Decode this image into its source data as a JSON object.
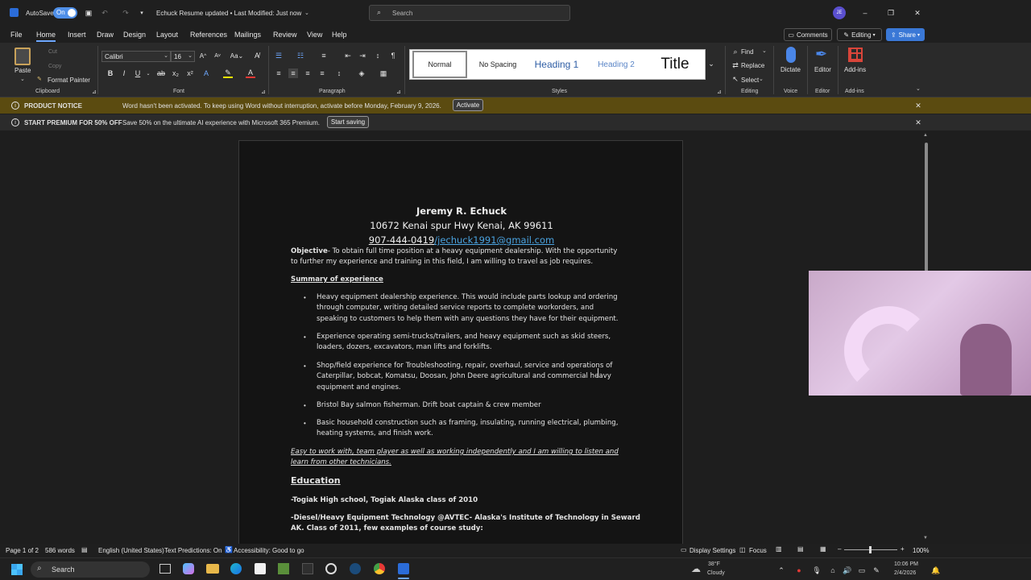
{
  "titlebar": {
    "autosave_label": "AutoSave",
    "autosave_state": "On",
    "doc_title": "Echuck Resume updated • Last Modified: Just now",
    "search_placeholder": "Search",
    "avatar_initials": "JE"
  },
  "menu": [
    "File",
    "Home",
    "Insert",
    "Draw",
    "Design",
    "Layout",
    "References",
    "Mailings",
    "Review",
    "View",
    "Help"
  ],
  "menu_right": {
    "comments": "Comments",
    "editing": "Editing",
    "share": "Share"
  },
  "ribbon": {
    "clipboard": {
      "paste": "Paste",
      "cut": "Cut",
      "copy": "Copy",
      "format_painter": "Format Painter",
      "label": "Clipboard"
    },
    "font": {
      "name": "Calibri",
      "size": "16",
      "label": "Font"
    },
    "paragraph": {
      "label": "Paragraph"
    },
    "styles": {
      "items": [
        "Normal",
        "No Spacing",
        "Heading 1",
        "Heading 2",
        "Title"
      ],
      "label": "Styles"
    },
    "editing": {
      "find": "Find",
      "replace": "Replace",
      "select": "Select",
      "label": "Editing"
    },
    "voice": {
      "dictate": "Dictate",
      "label": "Voice"
    },
    "editor": {
      "editor": "Editor",
      "label": "Editor"
    },
    "addins": {
      "addins": "Add-ins",
      "label": "Add-ins"
    }
  },
  "notice1": {
    "title": "PRODUCT NOTICE",
    "message": "Word hasn't been activated. To keep using Word without interruption, activate before Monday, February 9, 2026.",
    "button": "Activate"
  },
  "notice2": {
    "title": "START PREMIUM FOR 50% OFF",
    "message": "Save 50% on the ultimate AI experience with Microsoft 365 Premium.",
    "button": "Start saving"
  },
  "document": {
    "name": "Jeremy R. Echuck",
    "address": "10672 Kenai spur Hwy Kenai, AK 99611",
    "phone": "907-444-0419",
    "email": "/jechuck1991@gmail.com",
    "objective_label": "Objective",
    "objective_line1": "- To obtain full time position at a heavy equipment dealership. With the opportunity",
    "objective_line2": "to further my experience and training in this field, I am willing to travel as job requires.",
    "summary_heading": "Summary of experience",
    "bullets": [
      [
        "Heavy equipment dealership experience. This would include parts lookup and ordering",
        "through computer, writing detailed service reports to complete workorders, and",
        "speaking to customers to help them with any questions they have for their equipment."
      ],
      [
        "Experience operating semi-trucks/trailers, and heavy equipment such as skid steers,",
        "loaders, dozers, excavators, man lifts and forklifts."
      ],
      [
        "Shop/field experience for Troubleshooting, repair, overhaul, service and operations of",
        "Caterpillar, bobcat, Komatsu, Doosan, John Deere agricultural and commercial heavy",
        "equipment and engines."
      ],
      [
        "Bristol Bay salmon fisherman. Drift boat captain & crew member"
      ],
      [
        "Basic household construction such as framing, insulating, running electrical, plumbing,",
        "heating systems, and finish work."
      ]
    ],
    "italic_line1": "Easy to work with, team player as well as working independently and I am willing to listen and",
    "italic_line2": "learn from other technicians.",
    "education_heading": "Education",
    "edu1": "-Togiak High school, Togiak Alaska class of 2010",
    "edu2_line1": "-Diesel/Heavy Equipment Technology @AVTEC- Alaska's Institute of Technology in Seward",
    "edu2_line2": "AK. Class of 2011, few examples of course study:"
  },
  "statusbar": {
    "page": "Page 1 of 2",
    "words": "586 words",
    "language": "English (United States)",
    "predictions": "Text Predictions: On",
    "accessibility": "Accessibility: Good to go",
    "display": "Display Settings",
    "focus": "Focus",
    "zoom": "100%"
  },
  "taskbar": {
    "search": "Search",
    "weather_temp": "38°F",
    "weather_desc": "Cloudy",
    "time": "10:06 PM",
    "date": "2/4/2026"
  }
}
